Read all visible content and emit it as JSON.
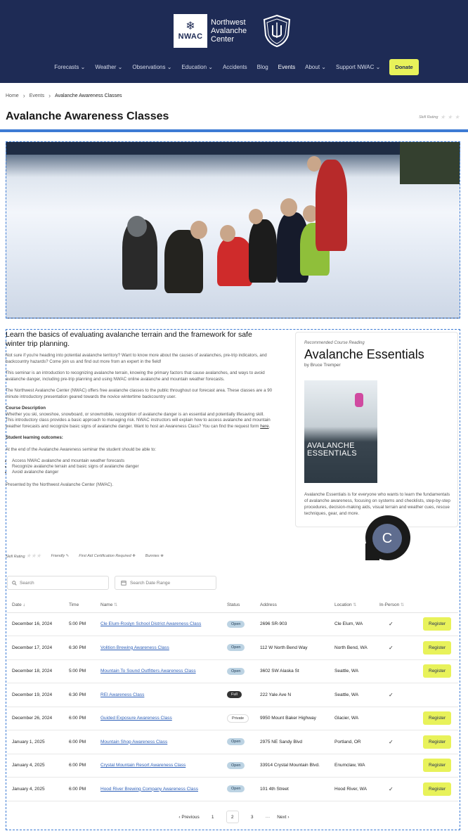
{
  "header": {
    "logo_abbrev": "NWAC",
    "logo_line1": "Northwest",
    "logo_line2": "Avalanche",
    "logo_line3": "Center",
    "nav": [
      {
        "label": "Forecasts",
        "chev": true
      },
      {
        "label": "Weather",
        "chev": true
      },
      {
        "label": "Observations",
        "chev": true
      },
      {
        "label": "Education",
        "chev": true
      },
      {
        "label": "Accidents",
        "chev": false
      },
      {
        "label": "Blog",
        "chev": false
      },
      {
        "label": "Events",
        "chev": false,
        "active": true
      },
      {
        "label": "About",
        "chev": true
      },
      {
        "label": "Support NWAC",
        "chev": true
      }
    ],
    "donate": "Donate"
  },
  "breadcrumb": {
    "home": "Home",
    "events": "Events",
    "current": "Avalanche Awareness Classes"
  },
  "page_title": "Avalanche Awareness Classes",
  "skill_rating_label": "Skill Rating",
  "intro": {
    "heading": "Learn the basics of evaluating avalanche terrain and the framework for safe winter trip planning.",
    "p1": "Not sure if you're heading into potential avalanche territory? Want to know more about the causes of avalanches, pre-trip indicators, and backcountry hazards? Come join us and find out more from an expert in the field!",
    "p2": "This seminar is an introduction to recognizing avalanche terrain, knowing the primary factors that cause avalanches, and ways to avoid avalanche danger, including pre-trip planning and using NWAC online avalanche and mountain weather forecasts.",
    "p3": "The Northwest Avalanche Center (NWAC) offers free avalanche classes to the public throughout our forecast area. These classes are a 90 minute introductory presentation geared towards the novice wintertime backcountry user.",
    "course_desc_title": "Course Description",
    "course_desc": "Whether you ski, snowshoe, snowboard, or snowmobile, recognition of avalanche danger is an essential and potentially lifesaving skill. This introductory class provides a basic approach to managing risk. NWAC instructors will explain how to access avalanche and mountain weather forecasts and recognize basic signs of avalanche danger. Want to host an Awareness Class? You can find the request form",
    "here_link": "here",
    "outcomes_title": "Student learning outcomes:",
    "outcomes_intro": "At the end of the Avalanche Awareness seminar the student should be able to:",
    "outcomes": [
      "Access NWAC avalanche and mountain weather forecasts",
      "Recognize avalanche terrain and basic signs of avalanche danger",
      "Avoid avalanche danger"
    ],
    "presented_by": "Presented by the Northwest Avalanche Center (NWAC)."
  },
  "tags": {
    "skill": "Skill Rating",
    "friendly": "Friendly",
    "first_aid": "First Aid Certification Required",
    "bunnies": "Bunnies"
  },
  "book": {
    "recommended": "Recommended Course Reading",
    "title": "Avalanche Essentials",
    "author": "by Bruce Tremper",
    "cover_line1": "AVALANCHE",
    "cover_line2": "ESSENTIALS",
    "description": "Avalanche Essentials is for everyone who wants to learn the fundamentals of avalanche awareness, focusing on systems and checklists, step-by-step procedures, decision-making aids, visual terrain and weather cues, rescue techniques, gear, and more."
  },
  "avatar_initial": "C",
  "filters": {
    "search_placeholder": "Search",
    "date_placeholder": "Search Date Range"
  },
  "table": {
    "headers": {
      "date": "Date",
      "time": "Time",
      "name": "Name",
      "status": "Status",
      "address": "Address",
      "location": "Location",
      "in_person": "In-Person"
    },
    "rows": [
      {
        "date": "December 16, 2024",
        "time": "5:00 PM",
        "name": "Cle Elum-Roslyn School District Awareness Class",
        "status": "Open",
        "address": "2696 SR-903",
        "location": "Cle Elum, WA",
        "in_person": true,
        "register": "Register"
      },
      {
        "date": "December 17, 2024",
        "time": "6:30 PM",
        "name": "Volition Brewing Awareness Class",
        "status": "Open",
        "address": "112 W North Bend Way",
        "location": "North Bend, WA",
        "in_person": true,
        "register": "Register"
      },
      {
        "date": "December 18, 2024",
        "time": "5:00 PM",
        "name": "Mountain To Sound Outfitters Awareness Class",
        "status": "Open",
        "address": "3602 SW Alaska St",
        "location": "Seattle, WA",
        "in_person": false,
        "register": "Register"
      },
      {
        "date": "December 19, 2024",
        "time": "6:30 PM",
        "name": "REI Awareness Class",
        "status": "Full",
        "address": "222 Yale Ave N",
        "location": "Seattle, WA",
        "in_person": true,
        "register": ""
      },
      {
        "date": "December 26, 2024",
        "time": "6:00 PM",
        "name": "Guided Exposure Awareness Class",
        "status": "Private",
        "address": "9950 Mount Baker Highway",
        "location": "Glacier, WA",
        "in_person": false,
        "register": "Register"
      },
      {
        "date": "January 1, 2025",
        "time": "6:00 PM",
        "name": "Mountain Shop Awareness Class",
        "status": "Open",
        "address": "2975 NE Sandy Blvd",
        "location": "Portland, OR",
        "in_person": true,
        "register": "Register"
      },
      {
        "date": "January 4, 2025",
        "time": "6:00 PM",
        "name": "Crystal Mountain Resort Awareness Class",
        "status": "Open",
        "address": "33914 Crystal Mountain Blvd.",
        "location": "Enumclaw, WA",
        "in_person": false,
        "register": "Register"
      },
      {
        "date": "January 4, 2025",
        "time": "6:00 PM",
        "name": "Hood River Brewing Company Awareness Class",
        "status": "Open",
        "address": "101 4th Street",
        "location": "Hood River, WA",
        "in_person": true,
        "register": "Register"
      }
    ]
  },
  "pagination": {
    "previous": "Previous",
    "pages": [
      "1",
      "2",
      "3"
    ],
    "current": "2",
    "ellipsis": "···",
    "next": "Next"
  }
}
